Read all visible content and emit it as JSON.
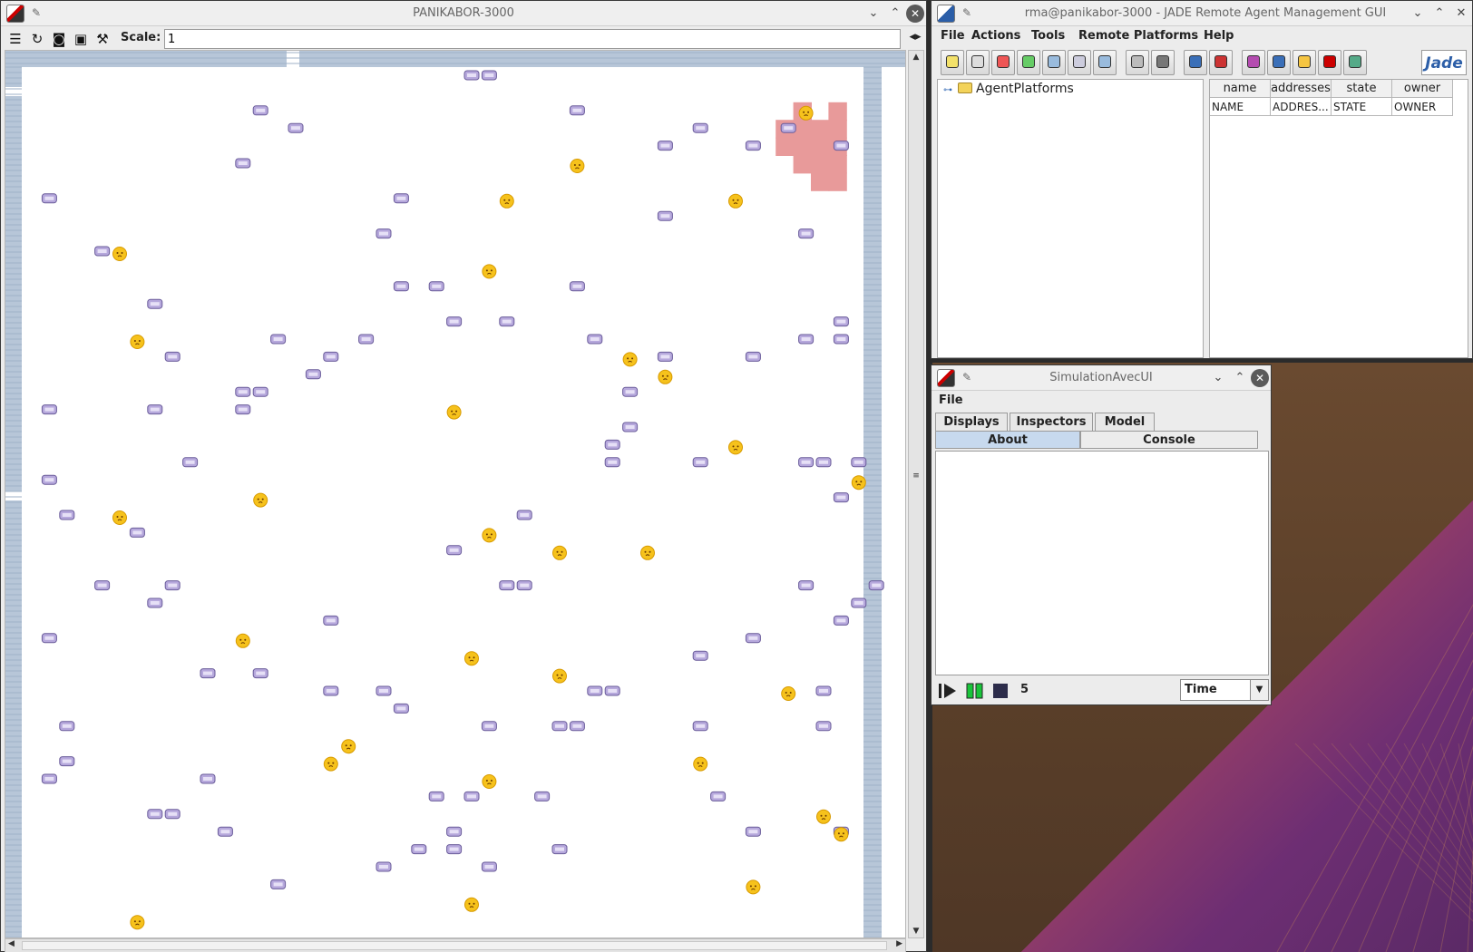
{
  "desktop": {
    "accent": "#6d2e73",
    "base": "#5a3f29"
  },
  "panikabor": {
    "title": "PANIKABOR-3000",
    "toolbar": {
      "scale_label": "Scale:",
      "scale_value": "1"
    },
    "icons": [
      "layers-icon",
      "refresh-icon",
      "movie-camera-icon",
      "camera-icon",
      "wrench-icon"
    ],
    "colors": {
      "wall": "#b7c6d8",
      "couch": "#b6a8dc",
      "face": "#f6c21c",
      "fire": "#e89a9a"
    }
  },
  "rma": {
    "title": "rma@panikabor-3000 - JADE Remote Agent Management GUI",
    "menu": [
      "File",
      "Actions",
      "Tools",
      "Remote Platforms",
      "Help"
    ],
    "tree_root": "AgentPlatforms",
    "table": {
      "headers": [
        "name",
        "addresses",
        "state",
        "owner"
      ],
      "row": [
        "NAME",
        "ADDRES...",
        "STATE",
        "OWNER"
      ]
    },
    "logo": "Jade"
  },
  "simulation": {
    "title": "SimulationAvecUI",
    "menu": [
      "File"
    ],
    "tabs_top": [
      "Displays",
      "Inspectors",
      "Model"
    ],
    "tabs_bottom": [
      "About",
      "Console"
    ],
    "selected_tab": "About",
    "step_count": "5",
    "time_select": "Time"
  }
}
